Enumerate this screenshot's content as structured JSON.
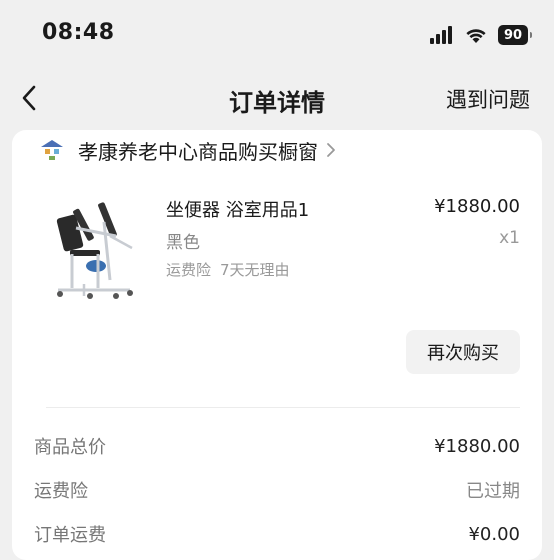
{
  "status_bar": {
    "time": "08:48",
    "battery": "90",
    "icons": [
      "cellular-signal-icon",
      "wifi-icon",
      "battery-icon"
    ]
  },
  "nav": {
    "back_icon": "chevron-left-icon",
    "title": "订单详情",
    "help_link": "遇到问题"
  },
  "store": {
    "name": "孝康养老中心商品购买橱窗",
    "logo_icon": "store-logo-icon",
    "chevron_icon": "chevron-right-icon"
  },
  "product": {
    "image_icon": "commode-lift-chair-image",
    "name": "坐便器 浴室用品1",
    "variant": "黑色",
    "services": [
      "运费险",
      "7天无理由"
    ],
    "price": "¥1880.00",
    "quantity": "x1"
  },
  "actions": {
    "rebuy": "再次购买"
  },
  "summary": {
    "rows": [
      {
        "label": "商品总价",
        "value": "¥1880.00"
      },
      {
        "label": "运费险",
        "value": "已过期"
      },
      {
        "label": "订单运费",
        "value": "¥0.00"
      }
    ]
  },
  "colors": {
    "page_background": "#f0f0f0",
    "card_background": "#ffffff",
    "secondary_text": "#888888",
    "button_background": "#f2f2f2"
  }
}
